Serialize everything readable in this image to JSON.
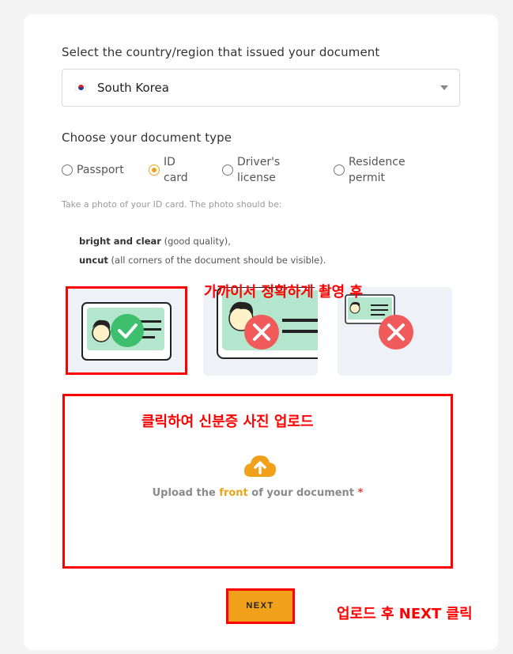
{
  "country": {
    "label": "Select the country/region that issued your document",
    "selected": "South Korea",
    "flag_icon": "south-korea-flag-icon"
  },
  "doctype": {
    "label": "Choose your document type",
    "options": [
      {
        "label": "Passport",
        "selected": false
      },
      {
        "label": "ID\ncard",
        "selected": true
      },
      {
        "label": "Driver's\nlicense",
        "selected": false
      },
      {
        "label": "Residence\npermit",
        "selected": false
      }
    ]
  },
  "instructions": {
    "hint": "Take a photo of your ID card. The photo should be:",
    "rule1_bold": "bright and clear",
    "rule1_rest": " (good quality),",
    "rule2_bold": "uncut",
    "rule2_rest": " (all corners of the document should be visible)."
  },
  "upload": {
    "prefix": "Upload the ",
    "accent": "front",
    "suffix": " of your document ",
    "required_mark": "*"
  },
  "next_label": "NEXT",
  "annotations": {
    "photo_tip": "가까이서 정확하게 촬영 후",
    "upload_tip": "클릭하여 신분증 사진 업로드",
    "next_tip": "업로드 후 NEXT 클릭"
  },
  "colors": {
    "accent": "#e8a51a",
    "button": "#f0a019",
    "good": "#3dbf6e",
    "bad": "#f05a5a",
    "annotation": "#ff0000"
  }
}
